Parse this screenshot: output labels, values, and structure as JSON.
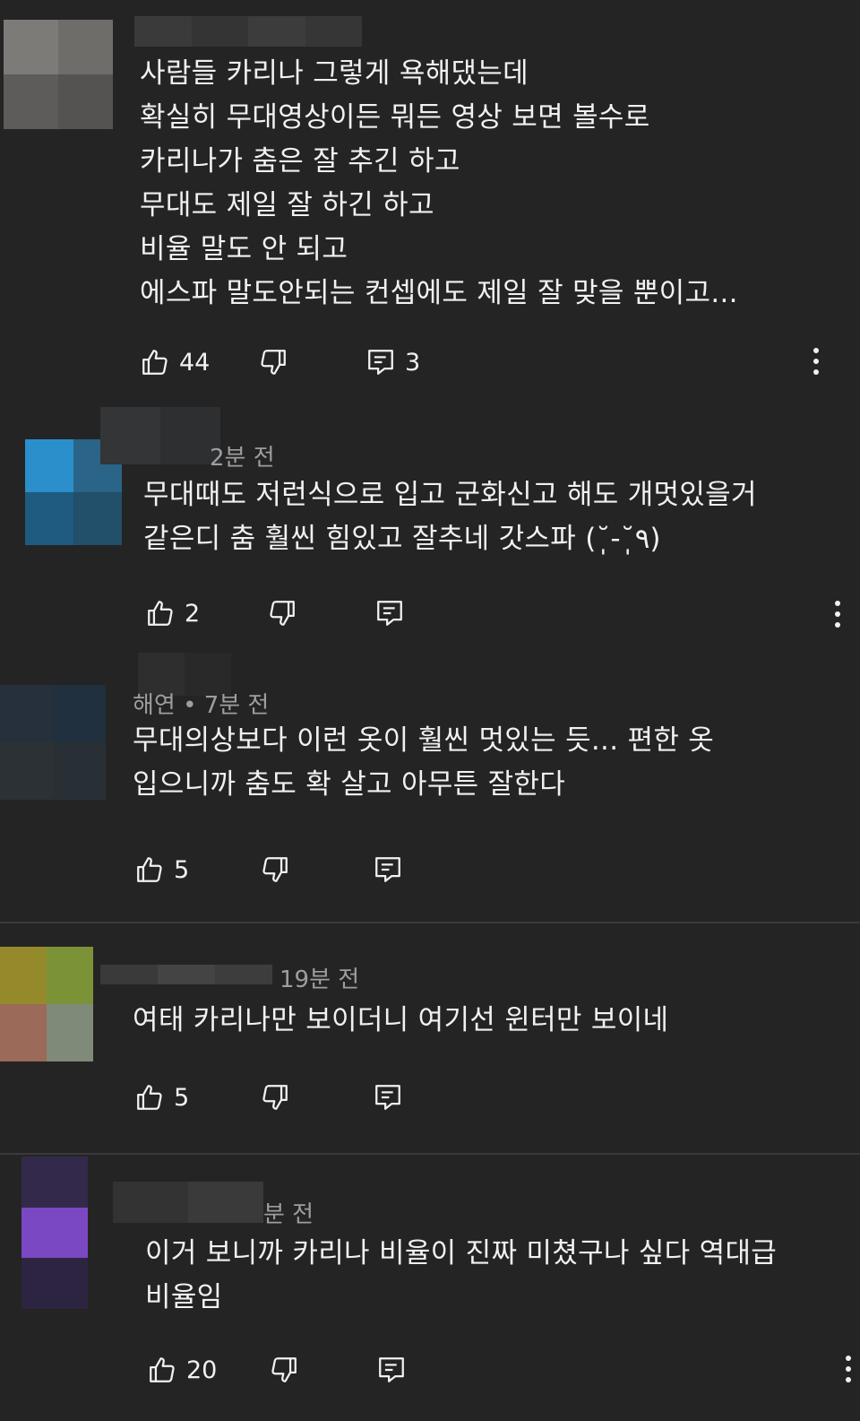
{
  "colors": {
    "background": "#242424",
    "text": "#f1f1f1",
    "meta": "#9e9e9e",
    "divider": "#3a3a3a"
  },
  "icons": {
    "like": "thumbs-up-icon",
    "dislike": "thumbs-down-icon",
    "reply": "reply-icon",
    "more": "more-vert-icon"
  },
  "comments": [
    {
      "meta": "",
      "text": "사람들 카리나 그렇게 욕해댔는데\n확실히 무대영상이든 뭐든 영상 보면 볼수로\n카리나가 춤은 잘 추긴 하고\n무대도 제일 잘 하긴 하고\n비율 말도 안 되고\n에스파 말도안되는 컨셉에도 제일 잘 맞을 뿐이고...",
      "likes": "44",
      "replies": "3"
    },
    {
      "meta": "2분 전",
      "text": "무대때도 저런식으로 입고 군화신고 해도 개멋있을거\n같은디 춤 훨씬 힘있고 잘추네 갓스파 (˘̩̩̩-˘̩̩̩٩)",
      "likes": "2",
      "replies": ""
    },
    {
      "meta": "해연 • 7분 전",
      "text": "무대의상보다 이런 옷이 훨씬 멋있는 듯... 편한 옷\n입으니까 춤도 확 살고 아무튼 잘한다",
      "likes": "5",
      "replies": ""
    },
    {
      "meta": "19분 전",
      "text": "여태 카리나만 보이더니 여기선 윈터만 보이네",
      "likes": "5",
      "replies": ""
    },
    {
      "meta": "분 전",
      "text": "이거 보니까 카리나 비율이 진짜 미쳤구나 싶다 역대급\n비율임",
      "likes": "20",
      "replies": ""
    }
  ]
}
